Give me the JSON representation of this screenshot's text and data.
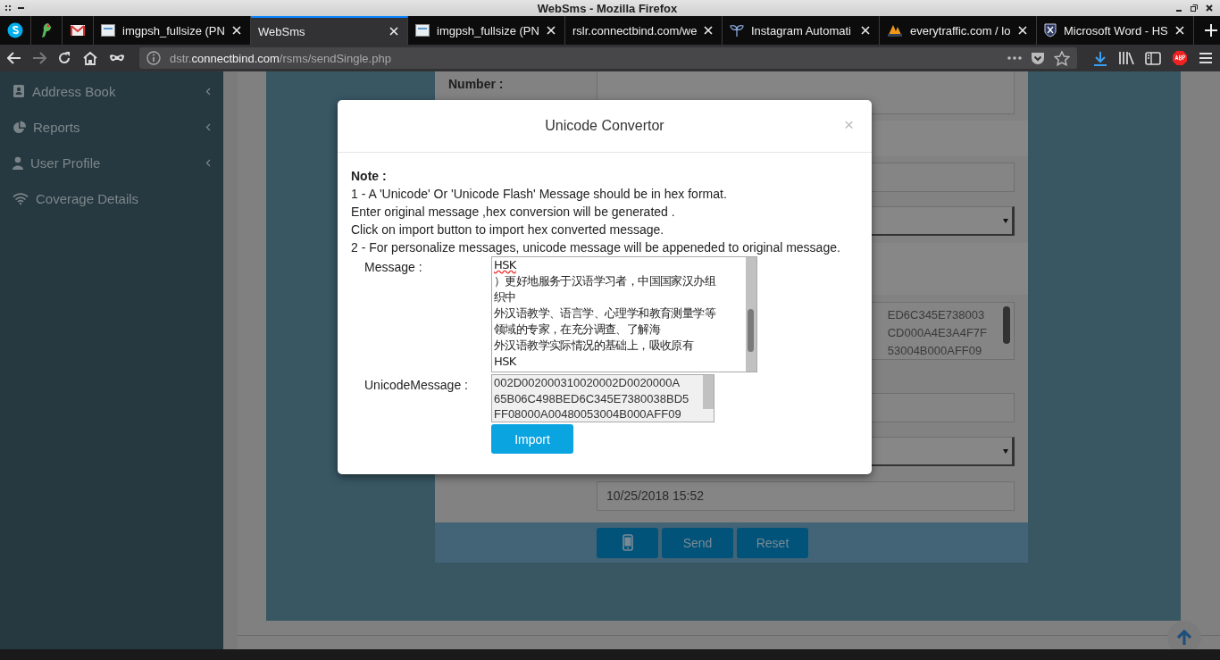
{
  "window": {
    "title": "WebSms - Mozilla Firefox"
  },
  "tabs": [
    {
      "kind": "pinned",
      "selected": false
    },
    {
      "kind": "pinned",
      "selected": false
    },
    {
      "kind": "pinned",
      "selected": false
    },
    {
      "kind": "normal",
      "label": "imgpsh_fullsize (PN",
      "selected": false
    },
    {
      "kind": "normal",
      "label": "WebSms",
      "selected": true
    },
    {
      "kind": "normal",
      "label": "imgpsh_fullsize (PN",
      "selected": false
    },
    {
      "kind": "normal",
      "label": "rslr.connectbind.com/we",
      "selected": false
    },
    {
      "kind": "normal",
      "label": "Instagram Automati",
      "selected": false
    },
    {
      "kind": "normal",
      "label": "everytraffic.com / lo",
      "selected": false
    },
    {
      "kind": "normal",
      "label": "Microsoft Word - HS",
      "selected": false
    }
  ],
  "address_bar": {
    "prefix": "dstr.",
    "domain": "connectbind.com",
    "path": "/rsms/sendSingle.php"
  },
  "sidebar": {
    "items": [
      {
        "label": "Address Book",
        "has_submenu": true
      },
      {
        "label": "Reports",
        "has_submenu": true
      },
      {
        "label": "User Profile",
        "has_submenu": true
      },
      {
        "label": "Coverage Details",
        "has_submenu": false
      }
    ]
  },
  "form": {
    "number_label": "Number :",
    "hex_lines": [
      "ED6C345E738003",
      "CD000A4E3A4F7F",
      "53004B000AFF09"
    ],
    "schedule": "10/25/2018 15:52",
    "buttons": [
      "Send",
      "Reset"
    ]
  },
  "modal": {
    "title": "Unicode Convertor",
    "close": "×",
    "note_title": "Note :",
    "note_lines": [
      "1 - A 'Unicode' Or 'Unicode Flash' Message should be in hex format.",
      "Enter original message ,hex conversion will be generated .",
      "Click on import button to import hex converted message.",
      "2 - For personalize messages, unicode message will be appeneded to original message."
    ],
    "message_label": "Message :",
    "message_lines": [
      "HSK",
      "）更好地服务于汉语学习者，中国国家汉办组",
      "织中",
      "外汉语教学、语言学、心理学和教育测量学等",
      "领域的专家，在充分调查、了解海",
      "外汉语教学实际情况的基础上，吸收原有",
      "HSK"
    ],
    "unicode_label": "UnicodeMessage :",
    "unicode_lines": [
      "002D002000310020002D0020000A",
      "65B06C498BED6C345E7380038BD5",
      "FF08000A00480053004B000AFF09"
    ],
    "import_button": "Import"
  }
}
